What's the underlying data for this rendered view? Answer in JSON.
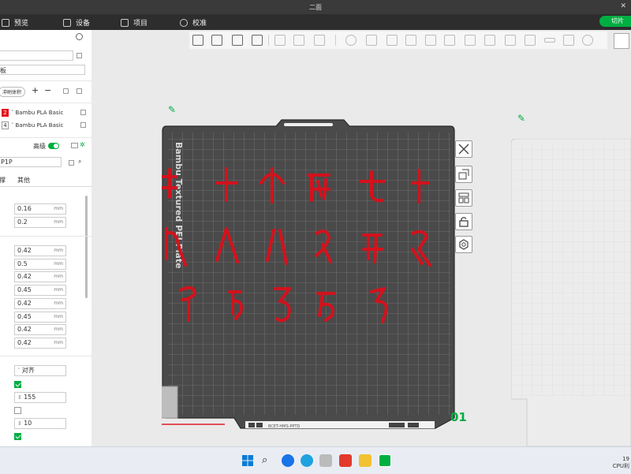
{
  "window": {
    "title": "二面"
  },
  "menu": {
    "preview": "预览",
    "device": "设备",
    "project": "项目",
    "calibrate": "校准",
    "slice": "切片"
  },
  "sidebar": {
    "plate_label": "板",
    "flush_volume": "冲刷体积",
    "filaments": [
      {
        "num": "2",
        "color": "#e8101c",
        "name": "Bambu PLA Basic"
      },
      {
        "num": "4",
        "color": "#ffffff",
        "name": "Bambu PLA Basic"
      }
    ],
    "advanced_label": "高级",
    "printer": "P1P",
    "tabs": [
      "撑",
      "其他"
    ],
    "layer_values": [
      "0.16",
      "0.2"
    ],
    "line_widths": [
      "0.42",
      "0.5",
      "0.42",
      "0.45",
      "0.42",
      "0.45",
      "0.42",
      "0.42"
    ],
    "unit": "mm",
    "align_option": "对齐",
    "spinner_value": "155",
    "count_value": "10"
  },
  "plate": {
    "name": "Bambu Textured PEI Plate",
    "number": "01",
    "label_text": "BCET-HMS-PPTD",
    "glyph_color": "#d3121d"
  },
  "tray": {
    "line1": "19",
    "line2": "CPU利"
  }
}
